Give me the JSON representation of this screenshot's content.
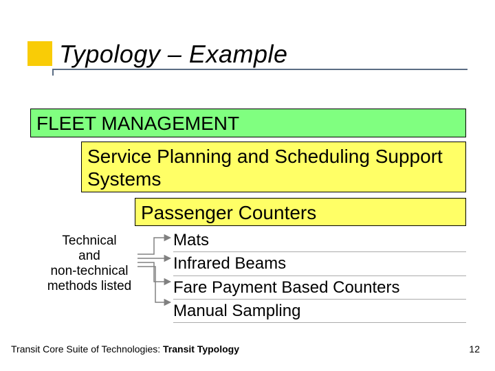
{
  "title": "Typology – Example",
  "boxes": {
    "fleet": "FLEET MANAGEMENT",
    "service": "Service Planning and Scheduling Support Systems",
    "passenger": "Passenger Counters"
  },
  "annotation": {
    "line1": "Technical",
    "line2": "and",
    "line3": "non-technical",
    "line4": "methods listed"
  },
  "items": [
    "Mats",
    "Infrared Beams",
    "Fare Payment Based Counters",
    "Manual Sampling"
  ],
  "footer": {
    "prefix": "Transit Core Suite of Technologies: ",
    "bold": "Transit Typology"
  },
  "page_number": "12",
  "colors": {
    "accent_square": "#f9cc06",
    "rule_line": "#5a6c83",
    "box_green": "#80ff80",
    "box_yellow": "#ffff66",
    "arrow": "#808080"
  }
}
